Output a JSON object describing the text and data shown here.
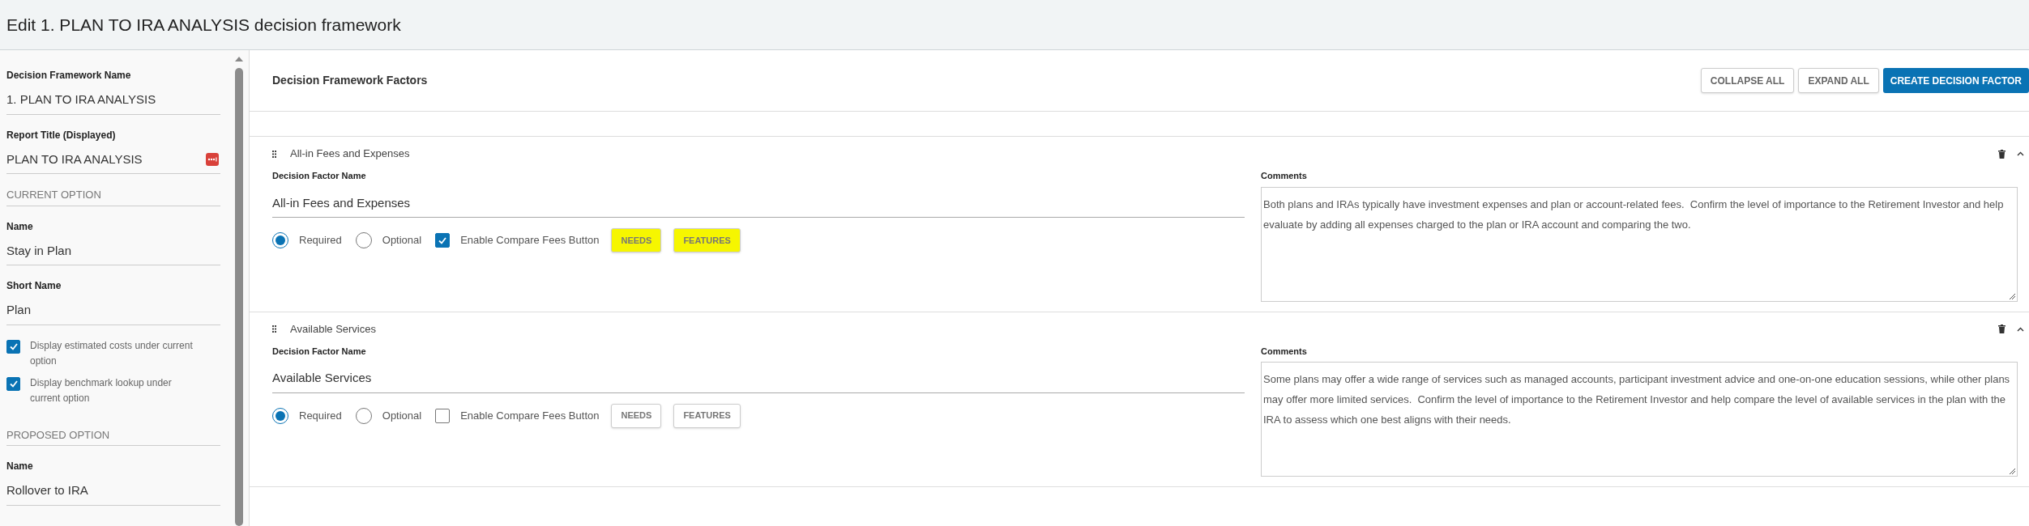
{
  "window": {
    "title": "Edit 1. PLAN TO IRA ANALYSIS decision framework"
  },
  "sidebar": {
    "items": [
      {
        "kind": "field",
        "label": "Decision Framework Name",
        "value": "1. PLAN TO IRA ANALYSIS"
      },
      {
        "kind": "field_with_icon",
        "label": "Report Title (Displayed)",
        "value": "PLAN TO IRA ANALYSIS"
      },
      {
        "kind": "section",
        "label": "CURRENT OPTION"
      },
      {
        "kind": "field",
        "label": "Name",
        "value": "Stay in Plan"
      },
      {
        "kind": "field",
        "label": "Short Name",
        "value": "Plan"
      },
      {
        "kind": "checkbox",
        "label": "Display estimated costs under current option",
        "checked": true
      },
      {
        "kind": "checkbox",
        "label": "Display benchmark lookup under current option",
        "checked": true
      },
      {
        "kind": "section",
        "label": "PROPOSED OPTION"
      },
      {
        "kind": "field",
        "label": "Name",
        "value": "Rollover to IRA"
      }
    ]
  },
  "main": {
    "title": "Decision Framework Factors",
    "buttons": [
      {
        "label": "COLLAPSE ALL",
        "kind": "secondary"
      },
      {
        "label": "EXPAND ALL",
        "kind": "secondary"
      },
      {
        "label": "CREATE DECISION FACTOR",
        "kind": "primary"
      }
    ],
    "factors": [
      {
        "title": "All-in Fees and Expenses",
        "name_label": "Decision Factor Name",
        "name_value": "All-in Fees and Expenses",
        "options": [
          {
            "label": "Required",
            "selected": true
          },
          {
            "label": "Optional",
            "selected": false
          }
        ],
        "compare_fees": {
          "label": "Enable Compare Fees Button",
          "checked": true
        },
        "buttons": [
          {
            "label": "NEEDS",
            "highlighted": true
          },
          {
            "label": "FEATURES",
            "highlighted": true
          }
        ],
        "comments_label": "Comments",
        "comments": "Both plans and IRAs typically have investment expenses and plan or account-related fees.  Confirm the level of importance to the Retirement Investor and help evaluate by adding all expenses charged to the plan or IRA account and comparing the two."
      },
      {
        "title": "Available Services",
        "name_label": "Decision Factor Name",
        "name_value": "Available Services",
        "options": [
          {
            "label": "Required",
            "selected": true
          },
          {
            "label": "Optional",
            "selected": false
          }
        ],
        "compare_fees": {
          "label": "Enable Compare Fees Button",
          "checked": false
        },
        "buttons": [
          {
            "label": "NEEDS",
            "highlighted": false
          },
          {
            "label": "FEATURES",
            "highlighted": false
          }
        ],
        "comments_label": "Comments",
        "comments": "Some plans may offer a wide range of services such as managed accounts, participant investment advice and one-on-one education sessions, while other plans may offer more limited services.  Confirm the level of importance to the Retirement Investor and help compare the level of available services in the plan with the IRA to assess which one best aligns with their needs."
      }
    ]
  }
}
